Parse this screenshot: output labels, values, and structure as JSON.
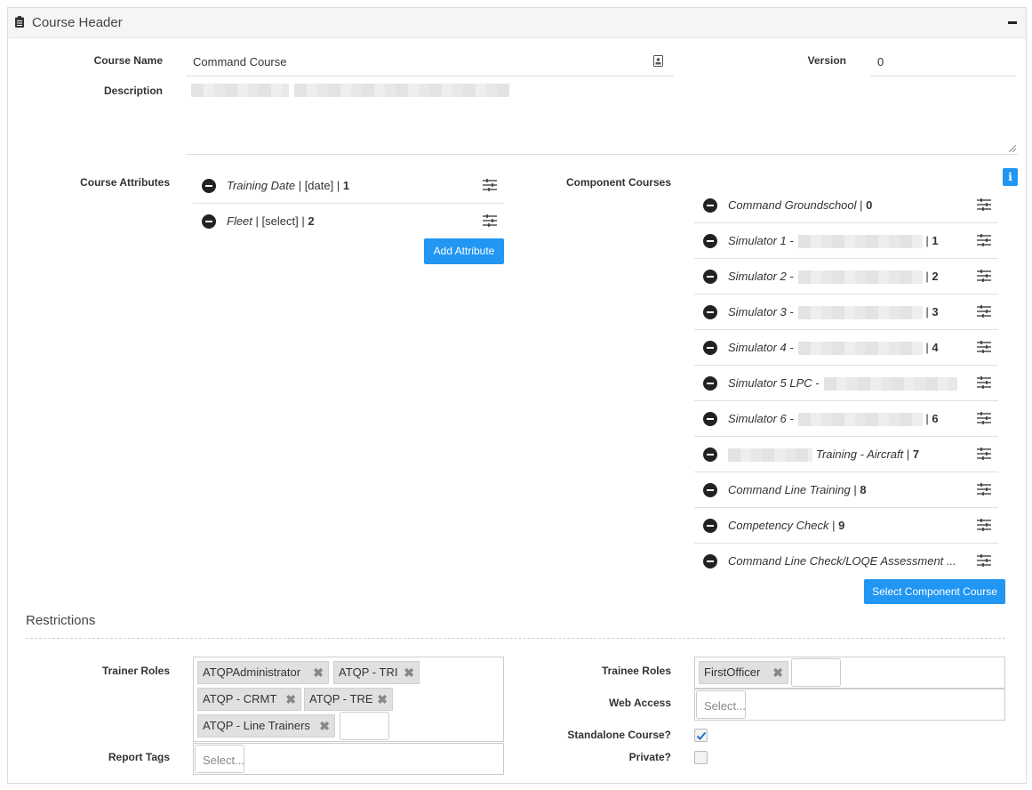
{
  "header": {
    "title": "Course Header"
  },
  "labels": {
    "course_name": "Course Name",
    "version": "Version",
    "description": "Description",
    "course_attributes": "Course Attributes",
    "component_courses": "Component Courses",
    "trainer_roles": "Trainer Roles",
    "trainee_roles": "Trainee Roles",
    "web_access": "Web Access",
    "standalone_course": "Standalone Course?",
    "private": "Private?",
    "report_tags": "Report Tags"
  },
  "fields": {
    "course_name": "Command Course",
    "version": "0"
  },
  "attributes": [
    {
      "name": "Training Date",
      "type": "[date]",
      "order": "1"
    },
    {
      "name": "Fleet",
      "type": "[select]",
      "order": "2"
    }
  ],
  "buttons": {
    "add_attribute": "Add Attribute",
    "select_component_course": "Select Component Course",
    "info": "i"
  },
  "component_courses": [
    {
      "name": "Command Groundschool",
      "sep": " | ",
      "order": "0"
    },
    {
      "name": "Simulator 1 -",
      "sep": " | ",
      "order": "1"
    },
    {
      "name": "Simulator 2 -",
      "sep": " | ",
      "order": "2"
    },
    {
      "name": "Simulator 3 -",
      "sep": " | ",
      "order": "3"
    },
    {
      "name": "Simulator 4 -",
      "sep": " | ",
      "order": "4"
    },
    {
      "name": "Simulator 5 LPC -",
      "sep": "",
      "order": ""
    },
    {
      "name": "Simulator 6 -",
      "sep": " | ",
      "order": "6"
    },
    {
      "name": "Training - Aircraft",
      "sep": " | ",
      "order": "7"
    },
    {
      "name": "Command Line Training",
      "sep": " | ",
      "order": "8"
    },
    {
      "name": "Competency Check",
      "sep": " | ",
      "order": "9"
    },
    {
      "name": "Command Line Check/LOQE Assessment ...",
      "sep": "",
      "order": ""
    }
  ],
  "restrictions": {
    "title": "Restrictions",
    "trainer_roles": [
      "ATQPAdministrator",
      "ATQP - TRI",
      "ATQP - CRMT",
      "ATQP - TRE",
      "ATQP - Line Trainers"
    ],
    "trainee_roles": [
      "FirstOfficer"
    ],
    "web_access_placeholder": "Select...",
    "report_tags_placeholder": "Select...",
    "standalone_course": true,
    "private": false
  },
  "colors": {
    "accent": "#2196f3"
  }
}
